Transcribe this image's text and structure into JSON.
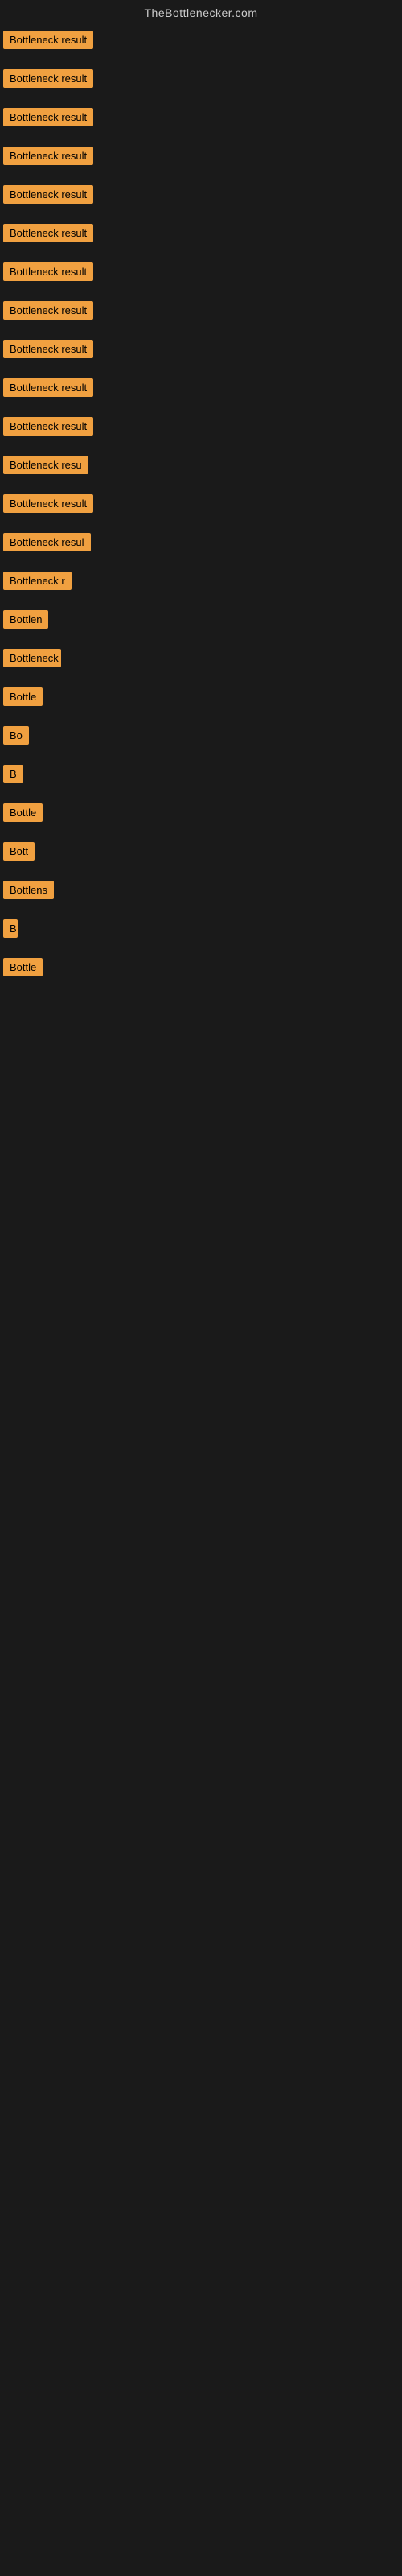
{
  "site": {
    "title": "TheBottlenecker.com"
  },
  "rows": [
    {
      "id": 1,
      "label": "Bottleneck result"
    },
    {
      "id": 2,
      "label": "Bottleneck result"
    },
    {
      "id": 3,
      "label": "Bottleneck result"
    },
    {
      "id": 4,
      "label": "Bottleneck result"
    },
    {
      "id": 5,
      "label": "Bottleneck result"
    },
    {
      "id": 6,
      "label": "Bottleneck result"
    },
    {
      "id": 7,
      "label": "Bottleneck result"
    },
    {
      "id": 8,
      "label": "Bottleneck result"
    },
    {
      "id": 9,
      "label": "Bottleneck result"
    },
    {
      "id": 10,
      "label": "Bottleneck result"
    },
    {
      "id": 11,
      "label": "Bottleneck result"
    },
    {
      "id": 12,
      "label": "Bottleneck resu"
    },
    {
      "id": 13,
      "label": "Bottleneck result"
    },
    {
      "id": 14,
      "label": "Bottleneck resul"
    },
    {
      "id": 15,
      "label": "Bottleneck r"
    },
    {
      "id": 16,
      "label": "Bottlen"
    },
    {
      "id": 17,
      "label": "Bottleneck"
    },
    {
      "id": 18,
      "label": "Bottle"
    },
    {
      "id": 19,
      "label": "Bo"
    },
    {
      "id": 20,
      "label": "B"
    },
    {
      "id": 21,
      "label": "Bottle"
    },
    {
      "id": 22,
      "label": "Bott"
    },
    {
      "id": 23,
      "label": "Bottlens"
    },
    {
      "id": 24,
      "label": "B"
    },
    {
      "id": 25,
      "label": "Bottle"
    }
  ]
}
